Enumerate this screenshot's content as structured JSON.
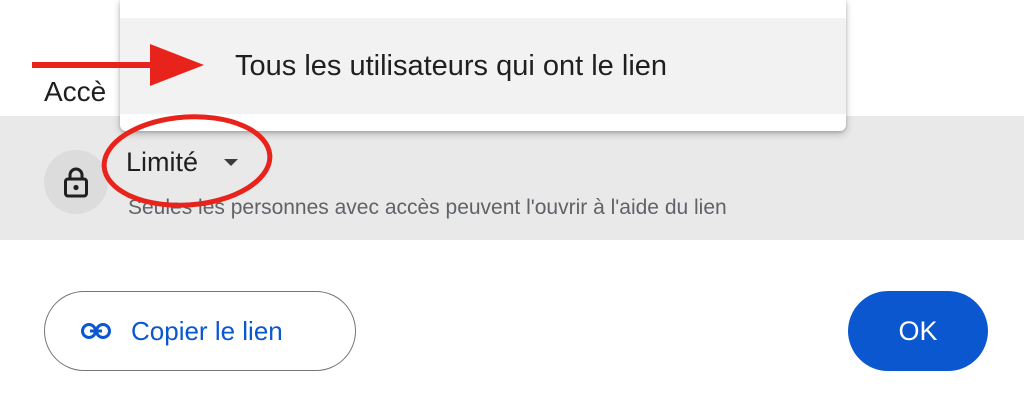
{
  "dialog": {
    "section_title": "Accè",
    "access": {
      "level_label": "Limité",
      "description": "Seules les personnes avec accès peuvent l'ouvrir à l'aide du lien"
    },
    "copy_link_label": "Copier le lien",
    "ok_label": "OK"
  },
  "menu": {
    "items": [
      {
        "label": "Tous les utilisateurs qui ont le lien"
      }
    ]
  },
  "colors": {
    "accent": "#0b57d0",
    "annotation": "#e8231c",
    "row_background": "#e9e9e9"
  },
  "icons": [
    "lock-icon",
    "link-icon",
    "caret-down-icon"
  ]
}
